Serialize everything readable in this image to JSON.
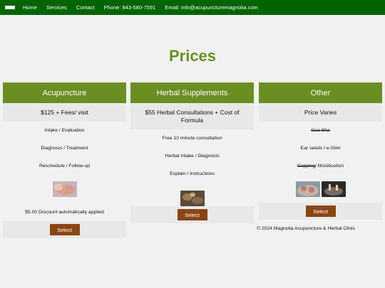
{
  "nav": {
    "home": "Home",
    "services": "Services",
    "contact": "Contact",
    "phone": "Phone: 843-580-7591",
    "email": "Email: info@acupuncturemagnolia.com"
  },
  "page_title": "Prices",
  "columns": [
    {
      "title": "Acupuncture",
      "price": "$125 + Fees/ visit",
      "items": [
        "Intake / Evaluation",
        "Diagnosis / Treatment",
        "Reschedule / Follow-up"
      ],
      "note": "$5.00 Discount automatically applied",
      "select_label": "Select"
    },
    {
      "title": "Herbal Supplements",
      "price": "$55 Herbal Consultations + Cost of Formula",
      "items": [
        "Free 10 minute consultation",
        "Herbal Intake / Diagnosis",
        "Explain / Instructions"
      ],
      "select_label": "Select"
    },
    {
      "title": "Other",
      "price": "Price Varies",
      "items": [
        "Gua Sha",
        "Ear seeds / e-Stim"
      ],
      "cupping": "Cupping",
      "moxibustion": " / Moxibustion",
      "select_label": "Select"
    }
  ],
  "copyright": "© 2024 Magnolia Acupuncture & Herbal Clinic",
  "colors": {
    "nav_bg": "#006400",
    "accent": "#6b8e23",
    "button": "#8b4513",
    "page_bg": "#f1f1f1"
  }
}
